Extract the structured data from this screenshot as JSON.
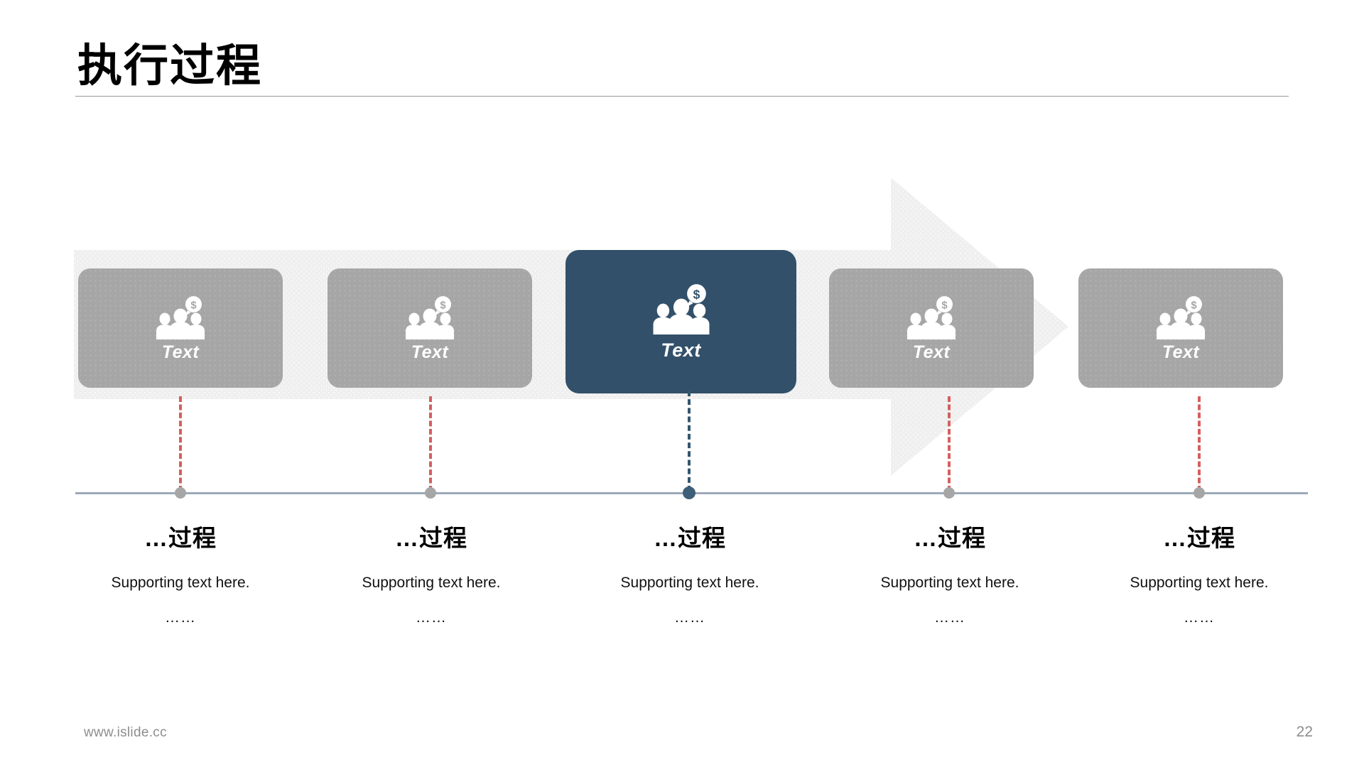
{
  "slide": {
    "title": "执行过程",
    "page_number": "22",
    "footer_url": "www.islide.cc",
    "accent_navy": "#325069",
    "accent_gray": "#a6a6a6",
    "accent_red_dash": "#d4605f",
    "band_color": "#efefef",
    "timeline_color": "#8b9bab"
  },
  "process": {
    "steps": [
      {
        "card_label": "Text",
        "icon": "people-money-icon",
        "active": false,
        "heading": "…过程",
        "support": "Supporting text here.",
        "ellipsis": "……",
        "dash_color": "#d4605f",
        "dot_color": "#a6a6a6"
      },
      {
        "card_label": "Text",
        "icon": "people-money-icon",
        "active": false,
        "heading": "…过程",
        "support": "Supporting text here.",
        "ellipsis": "……",
        "dash_color": "#d4605f",
        "dot_color": "#a6a6a6"
      },
      {
        "card_label": "Text",
        "icon": "people-money-icon",
        "active": true,
        "heading": "…过程",
        "support": "Supporting text here.",
        "ellipsis": "……",
        "dash_color": "#34566e",
        "dot_color": "#3d5f77"
      },
      {
        "card_label": "Text",
        "icon": "people-money-icon",
        "active": false,
        "heading": "…过程",
        "support": "Supporting text here.",
        "ellipsis": "……",
        "dash_color": "#d4605f",
        "dot_color": "#a6a6a6"
      },
      {
        "card_label": "Text",
        "icon": "people-money-icon",
        "active": false,
        "heading": "…过程",
        "support": "Supporting text here.",
        "ellipsis": "……",
        "dash_color": "#d4605f",
        "dot_color": "#a6a6a6"
      }
    ]
  }
}
